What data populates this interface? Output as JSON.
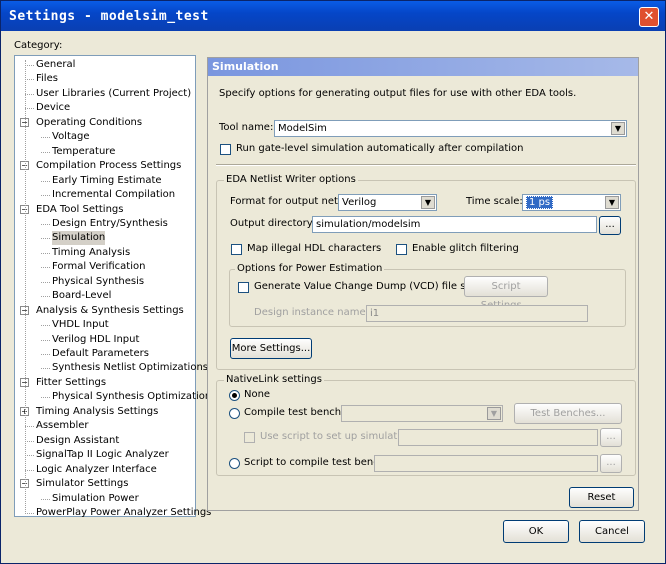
{
  "window": {
    "title": "Settings - modelsim_test",
    "close_icon": "close-icon"
  },
  "category_label": "Category:",
  "tree": [
    {
      "label": "General",
      "level": 0,
      "expander": ""
    },
    {
      "label": "Files",
      "level": 0,
      "expander": ""
    },
    {
      "label": "User Libraries (Current Project)",
      "level": 0,
      "expander": ""
    },
    {
      "label": "Device",
      "level": 0,
      "expander": ""
    },
    {
      "label": "Operating Conditions",
      "level": 0,
      "expander": "-"
    },
    {
      "label": "Voltage",
      "level": 1,
      "expander": ""
    },
    {
      "label": "Temperature",
      "level": 1,
      "expander": ""
    },
    {
      "label": "Compilation Process Settings",
      "level": 0,
      "expander": "-"
    },
    {
      "label": "Early Timing Estimate",
      "level": 1,
      "expander": ""
    },
    {
      "label": "Incremental Compilation",
      "level": 1,
      "expander": ""
    },
    {
      "label": "EDA Tool Settings",
      "level": 0,
      "expander": "-"
    },
    {
      "label": "Design Entry/Synthesis",
      "level": 1,
      "expander": ""
    },
    {
      "label": "Simulation",
      "level": 1,
      "expander": "",
      "selected": true
    },
    {
      "label": "Timing Analysis",
      "level": 1,
      "expander": ""
    },
    {
      "label": "Formal Verification",
      "level": 1,
      "expander": ""
    },
    {
      "label": "Physical Synthesis",
      "level": 1,
      "expander": ""
    },
    {
      "label": "Board-Level",
      "level": 1,
      "expander": ""
    },
    {
      "label": "Analysis & Synthesis Settings",
      "level": 0,
      "expander": "-"
    },
    {
      "label": "VHDL Input",
      "level": 1,
      "expander": ""
    },
    {
      "label": "Verilog HDL Input",
      "level": 1,
      "expander": ""
    },
    {
      "label": "Default Parameters",
      "level": 1,
      "expander": ""
    },
    {
      "label": "Synthesis Netlist Optimizations",
      "level": 1,
      "expander": ""
    },
    {
      "label": "Fitter Settings",
      "level": 0,
      "expander": "-"
    },
    {
      "label": "Physical Synthesis Optimizations",
      "level": 1,
      "expander": ""
    },
    {
      "label": "Timing Analysis Settings",
      "level": 0,
      "expander": "+"
    },
    {
      "label": "Assembler",
      "level": 0,
      "expander": ""
    },
    {
      "label": "Design Assistant",
      "level": 0,
      "expander": ""
    },
    {
      "label": "SignalTap II Logic Analyzer",
      "level": 0,
      "expander": ""
    },
    {
      "label": "Logic Analyzer Interface",
      "level": 0,
      "expander": ""
    },
    {
      "label": "Simulator Settings",
      "level": 0,
      "expander": "-"
    },
    {
      "label": "Simulation Power",
      "level": 1,
      "expander": ""
    },
    {
      "label": "PowerPlay Power Analyzer Settings",
      "level": 0,
      "expander": ""
    }
  ],
  "panel": {
    "title": "Simulation",
    "description": "Specify options for generating output files for use with other EDA tools.",
    "tool_name_label": "Tool name:",
    "tool_name_value": "ModelSim",
    "run_gate_level_label": "Run gate-level simulation automatically after compilation",
    "netlist_group": "EDA Netlist Writer options",
    "format_label": "Format for output netlist:",
    "format_value": "Verilog",
    "timescale_label": "Time scale:",
    "timescale_value": "1 ps",
    "output_dir_label": "Output directory:",
    "output_dir_value": "simulation/modelsim",
    "browse_label": "...",
    "map_illegal_label": "Map illegal HDL characters",
    "glitch_label": "Enable glitch filtering",
    "power_group": "Options for Power Estimation",
    "vcd_label": "Generate Value Change Dump (VCD) file script",
    "script_settings_label": "Script Settings...",
    "design_instance_label": "Design instance name:",
    "design_instance_value": "i1",
    "more_settings_label": "More Settings...",
    "nativelink_group": "NativeLink settings",
    "none_label": "None",
    "compile_bench_label": "Compile test bench:",
    "test_benches_label": "Test Benches...",
    "use_script_label": "Use script to set up simulation:",
    "script_compile_label": "Script to compile test bench:",
    "reset_label": "Reset"
  },
  "footer": {
    "ok_label": "OK",
    "cancel_label": "Cancel"
  }
}
